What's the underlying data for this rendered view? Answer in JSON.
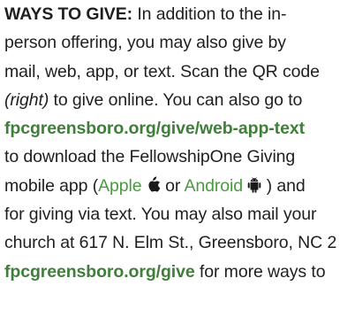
{
  "section": {
    "label": "WAYS TO GIVE:",
    "line1_rest": " In addition to the in-",
    "line2": "person offering, you may also give by",
    "line3": "mail, web, app, or text. Scan the QR code",
    "line4_italic": "(right)",
    "line4_rest": " to give online. You can also go to",
    "line5_link": "fpcgreensboro.org/give/web-app-text",
    "line6": "to download the FellowshipOne Giving",
    "line7_pre": "mobile app (",
    "apple_label": "Apple",
    "line7_mid": " or ",
    "android_label": "Android",
    "line7_post": " ) and",
    "line8": "for giving via text. You may also mail your",
    "line9": "church at 617 N. Elm St., Greensboro, NC 2",
    "line10_link": "fpcgreensboro.org/give",
    "line10_rest": " for more ways to"
  },
  "icons": {
    "apple": "apple-icon",
    "android": "android-icon"
  },
  "colors": {
    "text": "#1f1f1f",
    "link": "#3f7f3a",
    "link_light": "#4b9a42"
  }
}
